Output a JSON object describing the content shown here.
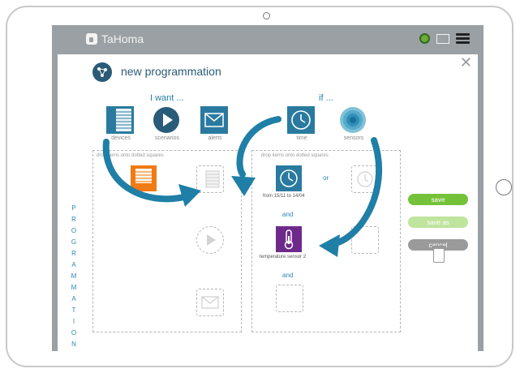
{
  "app": {
    "logo_text": "TaHoma"
  },
  "header": {
    "title": "new programmation"
  },
  "labels": {
    "i_want": "I want ...",
    "if": "if ..."
  },
  "top_items": [
    {
      "name": "devices",
      "label": "devices"
    },
    {
      "name": "scenarios",
      "label": "scenarios"
    },
    {
      "name": "alerts",
      "label": "alerts"
    },
    {
      "name": "time",
      "label": "time"
    },
    {
      "name": "sensors",
      "label": "sensors"
    }
  ],
  "boxes": {
    "left_hint": "drop items onto dotted squares",
    "right_hint": "drop items onto dotted squares",
    "or": "or",
    "and1": "and",
    "and2": "and",
    "time_range": "from 15/11 to 14/04",
    "sensor_label": "temperature sensor 2"
  },
  "sidebar": {
    "vertical_text": "PROGRAMMATION"
  },
  "buttons": {
    "save": "save",
    "save_as": "save as",
    "cancel": "cancel"
  },
  "icons": {
    "header": "network-icon",
    "devices": "shutter-icon",
    "scenarios": "play-icon",
    "alerts": "envelope-icon",
    "time": "clock-icon",
    "sensors": "sensor-waves-icon"
  }
}
